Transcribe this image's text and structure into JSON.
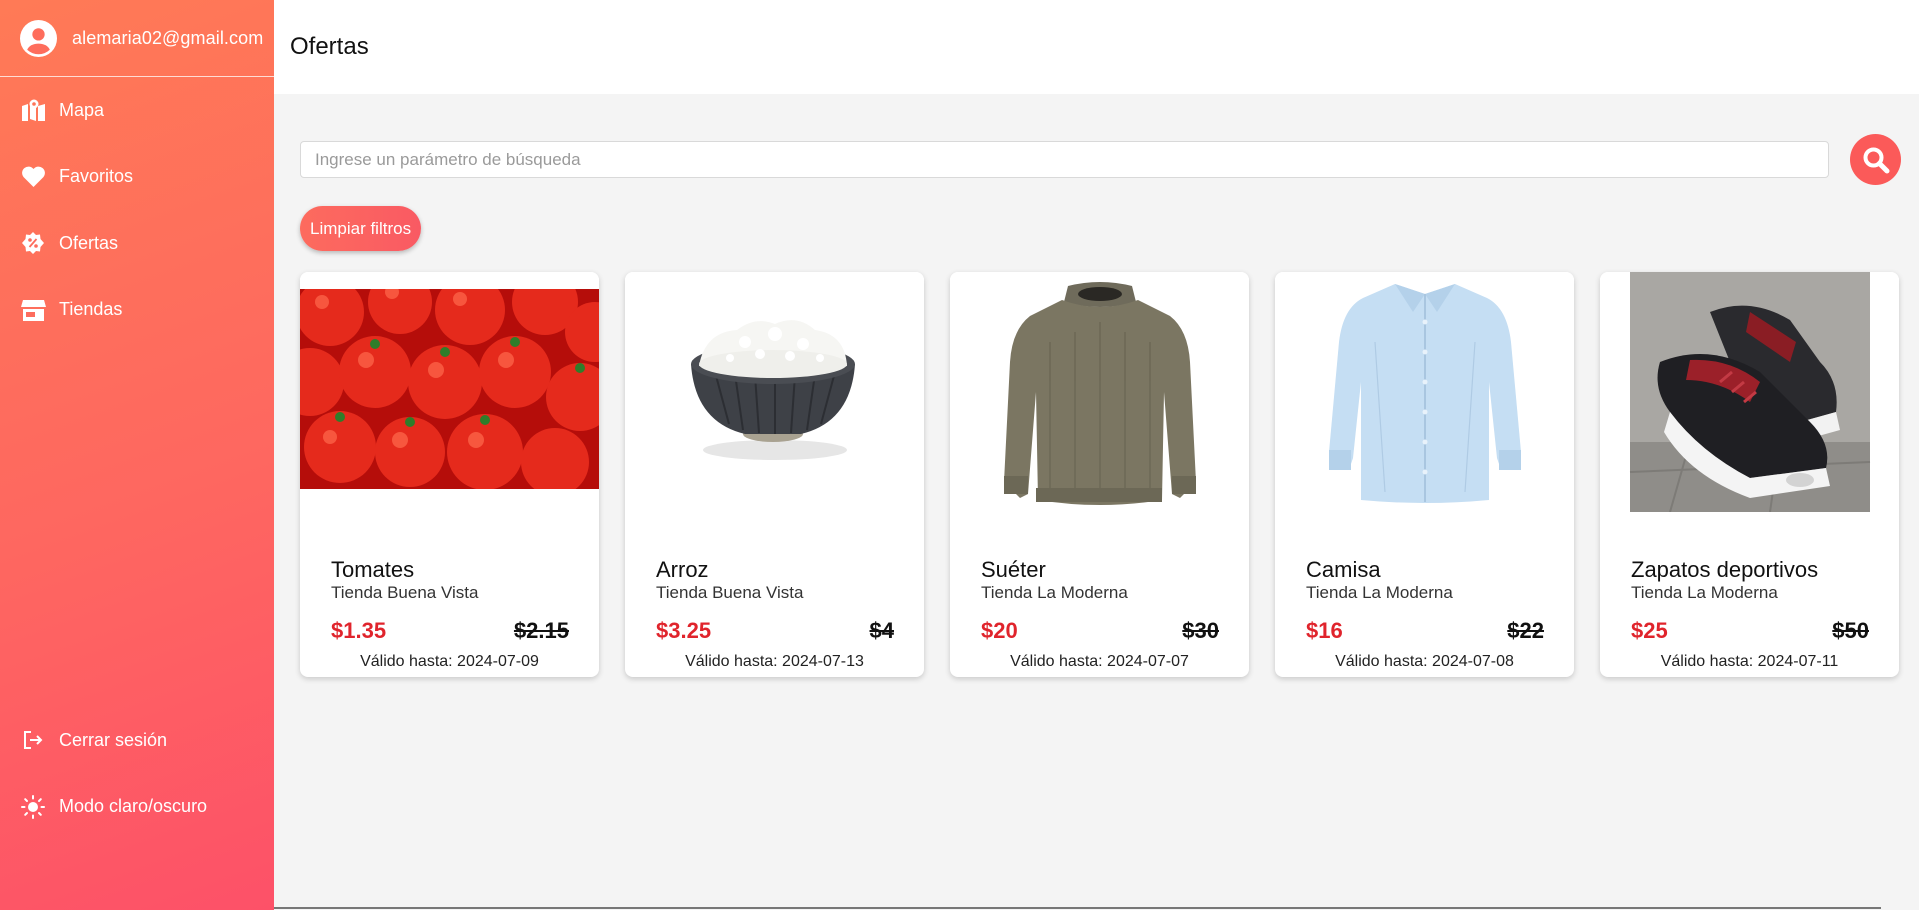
{
  "sidebar": {
    "user_email": "alemaria02@gmail.com",
    "nav": [
      {
        "label": "Mapa",
        "icon": "map-icon"
      },
      {
        "label": "Favoritos",
        "icon": "heart-icon"
      },
      {
        "label": "Ofertas",
        "icon": "discount-icon"
      },
      {
        "label": "Tiendas",
        "icon": "store-icon"
      }
    ],
    "bottom": [
      {
        "label": "Cerrar sesión",
        "icon": "logout-icon"
      },
      {
        "label": "Modo claro/oscuro",
        "icon": "sun-icon"
      }
    ],
    "gradient_colors": [
      "#ff7a56",
      "#fd5168"
    ]
  },
  "header": {
    "title": "Ofertas"
  },
  "search": {
    "placeholder": "Ingrese un parámetro de búsqueda",
    "value": "",
    "button_icon": "search-icon",
    "button_color": "#fb5a59"
  },
  "filters": {
    "clear_label": "Limpiar filtros"
  },
  "products": [
    {
      "name": "Tomates",
      "store": "Tienda Buena Vista",
      "price": "$1.35",
      "old_price": "$2.15",
      "valid": "Válido hasta: 2024-07-09",
      "image": "tomatoes-image"
    },
    {
      "name": "Arroz",
      "store": "Tienda Buena Vista",
      "price": "$3.25",
      "old_price": "$4",
      "valid": "Válido hasta: 2024-07-13",
      "image": "rice-bowl-image"
    },
    {
      "name": "Suéter",
      "store": "Tienda La Moderna",
      "price": "$20",
      "old_price": "$30",
      "valid": "Válido hasta: 2024-07-07",
      "image": "sweater-image"
    },
    {
      "name": "Camisa",
      "store": "Tienda La Moderna",
      "price": "$16",
      "old_price": "$22",
      "valid": "Válido hasta: 2024-07-08",
      "image": "shirt-image"
    },
    {
      "name": "Zapatos deportivos",
      "store": "Tienda La Moderna",
      "price": "$25",
      "old_price": "$50",
      "valid": "Válido hasta: 2024-07-11",
      "image": "sneakers-image"
    }
  ],
  "colors": {
    "price_new": "#e0242c",
    "accent": "#fb5a59",
    "background": "#f4f4f4"
  }
}
